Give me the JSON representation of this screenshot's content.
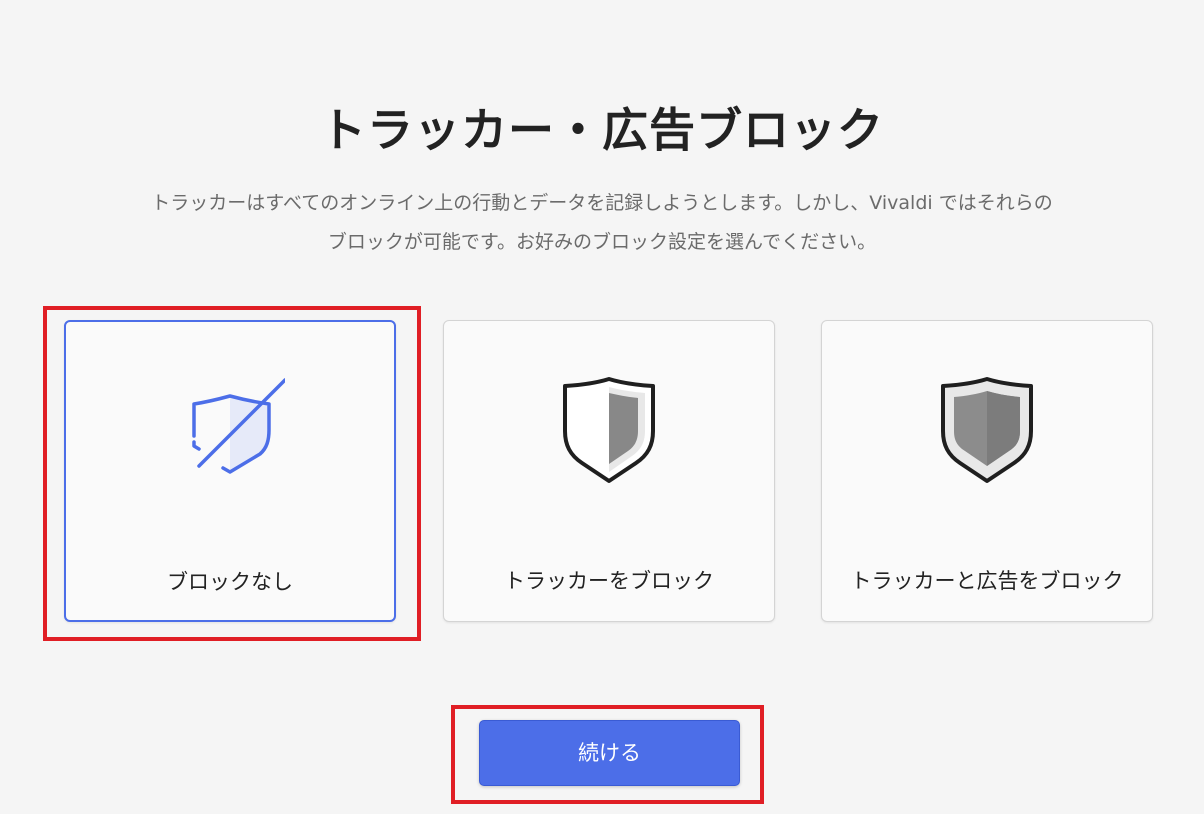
{
  "header": {
    "title": "トラッカー・広告ブロック",
    "subtitle_line1": "トラッカーはすべてのオンライン上の行動とデータを記録しようとします。しかし、Vivaldi ではそれらの",
    "subtitle_line2": "ブロックが可能です。お好みのブロック設定を選んでください。"
  },
  "options": [
    {
      "label": "ブロックなし",
      "icon": "shield-off-icon",
      "selected": true
    },
    {
      "label": "トラッカーをブロック",
      "icon": "shield-half-icon",
      "selected": false
    },
    {
      "label": "トラッカーと広告をブロック",
      "icon": "shield-full-icon",
      "selected": false
    }
  ],
  "continue_button": {
    "label": "続ける"
  },
  "colors": {
    "accent": "#4c6ee8",
    "highlight": "#e01e25",
    "background": "#f5f5f5"
  }
}
